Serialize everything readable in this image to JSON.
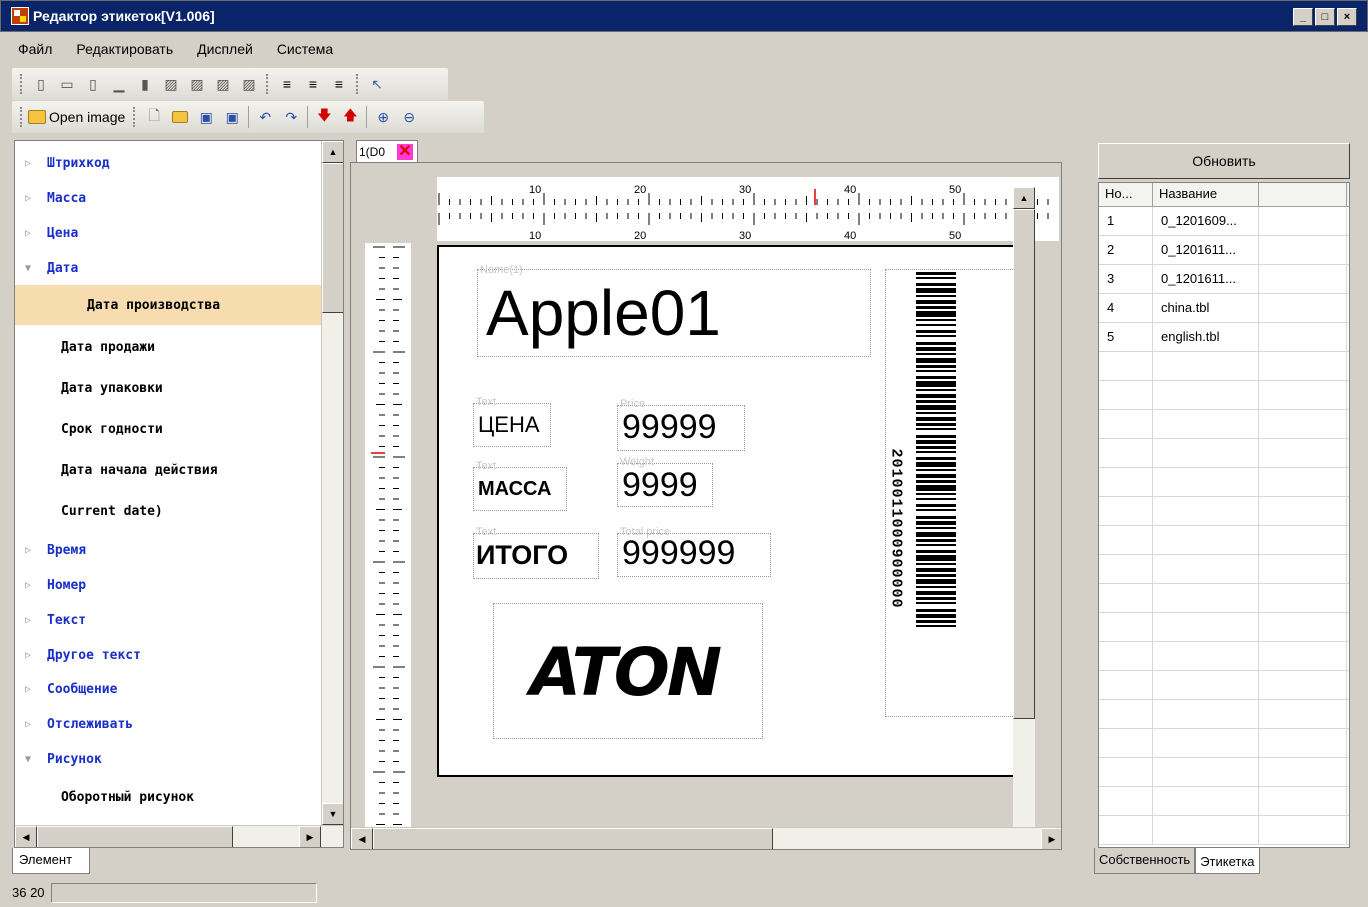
{
  "window": {
    "title": "Редактор этикеток[V1.006]",
    "min": "_",
    "max": "□",
    "close": "×"
  },
  "menu": [
    "Файл",
    "Редактировать",
    "Дисплей",
    "Система"
  ],
  "toolbar2": {
    "open_label": "Open image"
  },
  "tree": [
    {
      "label": "Штрихкод",
      "type": "category",
      "expanded": false
    },
    {
      "label": "Масса",
      "type": "category",
      "expanded": false
    },
    {
      "label": "Цена",
      "type": "category",
      "expanded": false
    },
    {
      "label": "Дата",
      "type": "category",
      "expanded": true
    },
    {
      "label": "Дата производства",
      "type": "sub",
      "selected": true
    },
    {
      "label": "Дата продажи",
      "type": "sub"
    },
    {
      "label": "Дата упаковки",
      "type": "sub"
    },
    {
      "label": "Срок годности",
      "type": "sub"
    },
    {
      "label": "Дата начала действия",
      "type": "sub"
    },
    {
      "label": "Current date)",
      "type": "sub"
    },
    {
      "label": "Время",
      "type": "category",
      "expanded": false
    },
    {
      "label": "Номер",
      "type": "category",
      "expanded": false
    },
    {
      "label": "Текст",
      "type": "category",
      "expanded": false
    },
    {
      "label": "Другое текст",
      "type": "category",
      "expanded": false
    },
    {
      "label": "Сообщение",
      "type": "category",
      "expanded": false
    },
    {
      "label": "Отслеживать",
      "type": "category",
      "expanded": false
    },
    {
      "label": "Рисунок",
      "type": "category",
      "expanded": true
    },
    {
      "label": "Оборотный рисунок",
      "type": "sub"
    }
  ],
  "left_tab": "Элемент",
  "doc_tab": "1(D0",
  "ruler": {
    "marks": [
      "10",
      "20",
      "30",
      "40",
      "50"
    ]
  },
  "label": {
    "name_field": {
      "caption": "Name(1)",
      "value": "Apple01"
    },
    "text1": {
      "caption": "Text",
      "value": "ЦЕНА"
    },
    "price": {
      "caption": "Price",
      "value": "99999"
    },
    "text2": {
      "caption": "Text",
      "value": "МАССА"
    },
    "weight": {
      "caption": "Weight",
      "value": "9999"
    },
    "text3": {
      "caption": "Text",
      "value": "ИТОГО"
    },
    "total": {
      "caption": "Total price",
      "value": "999999"
    },
    "logo": "ATON",
    "barcode_digits": "2010011000900000"
  },
  "right": {
    "refresh": "Обновить",
    "headers": [
      "Но...",
      "Название"
    ],
    "rows": [
      {
        "no": "1",
        "name": "0_1201609..."
      },
      {
        "no": "2",
        "name": "0_1201611..."
      },
      {
        "no": "3",
        "name": "0_1201611..."
      },
      {
        "no": "4",
        "name": "china.tbl"
      },
      {
        "no": "5",
        "name": "english.tbl"
      }
    ],
    "tabs": [
      "Собственность",
      "Этикетка"
    ]
  },
  "status": {
    "coords": "36  20"
  }
}
